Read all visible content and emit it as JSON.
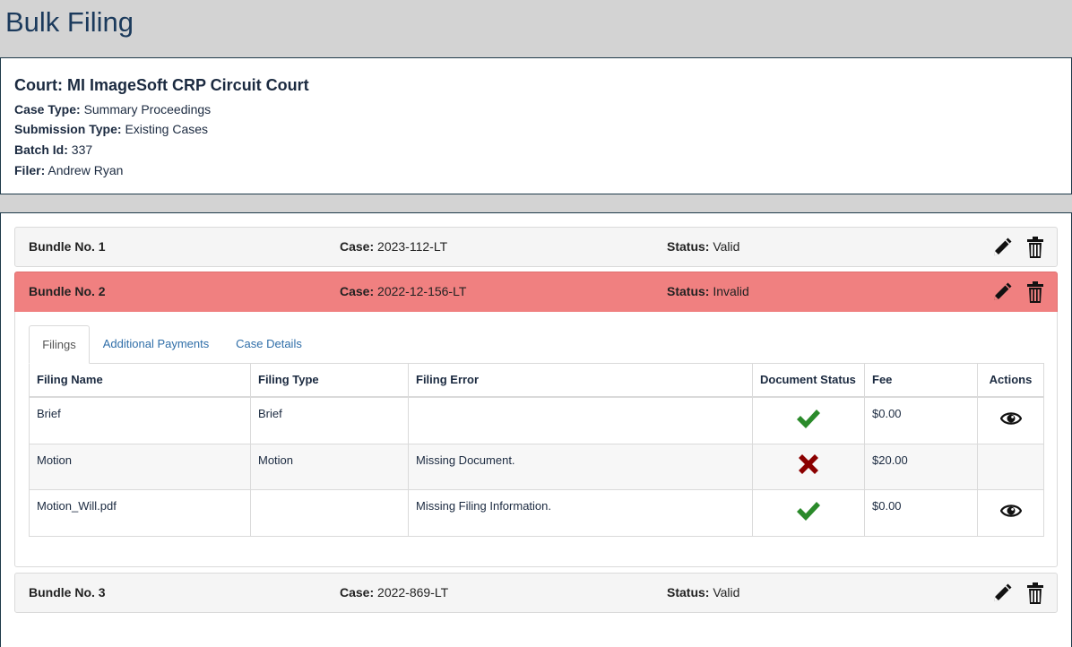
{
  "page": {
    "title": "Bulk Filing"
  },
  "court": {
    "title": "Court: MI ImageSoft CRP Circuit Court",
    "case_type_label": "Case Type:",
    "case_type": "Summary Proceedings",
    "submission_type_label": "Submission Type:",
    "submission_type": "Existing Cases",
    "batch_id_label": "Batch Id:",
    "batch_id": "337",
    "filer_label": "Filer:",
    "filer": "Andrew Ryan"
  },
  "labels": {
    "case": "Case:",
    "status": "Status:"
  },
  "bundles": [
    {
      "name": "Bundle No. 1",
      "case": "2023-112-LT",
      "status": "Valid"
    },
    {
      "name": "Bundle No. 2",
      "case": "2022-12-156-LT",
      "status": "Invalid"
    },
    {
      "name": "Bundle No. 3",
      "case": "2022-869-LT",
      "status": "Valid"
    }
  ],
  "tabs": [
    {
      "label": "Filings",
      "active": true
    },
    {
      "label": "Additional Payments",
      "active": false
    },
    {
      "label": "Case Details",
      "active": false
    }
  ],
  "filings_table": {
    "columns": [
      "Filing Name",
      "Filing Type",
      "Filing Error",
      "Document Status",
      "Fee",
      "Actions"
    ],
    "rows": [
      {
        "name": "Brief",
        "type": "Brief",
        "error": "",
        "doc_status": "check-icon",
        "fee": "$0.00",
        "action": "eye-icon"
      },
      {
        "name": "Motion",
        "type": "Motion",
        "error": "Missing Document.",
        "doc_status": "x-icon",
        "fee": "$20.00",
        "action": ""
      },
      {
        "name": "Motion_Will.pdf",
        "type": "",
        "error": "Missing Filing Information.",
        "doc_status": "check-icon",
        "fee": "$0.00",
        "action": "eye-icon"
      }
    ]
  },
  "colors": {
    "invalid_header": "#f08080",
    "check": "#2a8a2a",
    "cross": "#8b0000",
    "error_text": "#8b0000",
    "link": "#2f6ea8"
  }
}
